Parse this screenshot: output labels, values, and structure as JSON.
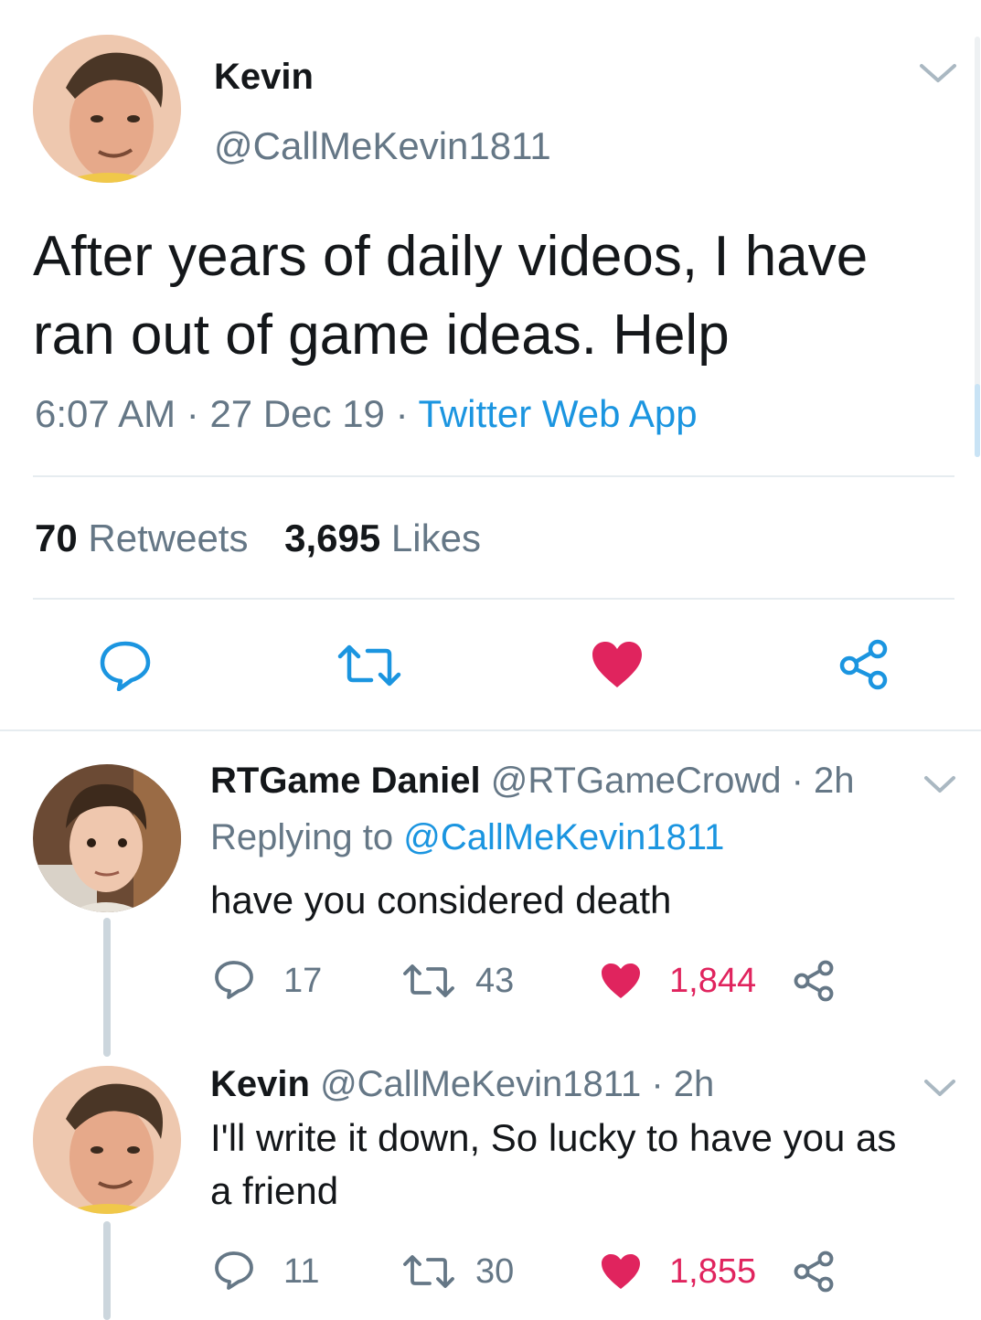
{
  "main_tweet": {
    "author_name": "Kevin",
    "author_handle": "@CallMeKevin1811",
    "text_line1": "After years of daily videos, I have",
    "text_line2": "ran out of game ideas. Help",
    "time": "6:07 AM",
    "sep1": "·",
    "date": "27 Dec 19",
    "sep2": "·",
    "source": "Twitter Web App",
    "retweets_count": "70",
    "retweets_label": "Retweets",
    "likes_count": "3,695",
    "likes_label": "Likes"
  },
  "replies": [
    {
      "author_name": "RTGame Daniel",
      "author_handle": "@RTGameCrowd",
      "time": "· 2h",
      "replying_prefix": "Replying to",
      "replying_handle": "@CallMeKevin1811",
      "text": "have you considered death",
      "reply_count": "17",
      "retweet_count": "43",
      "like_count": "1,844"
    },
    {
      "author_name": "Kevin",
      "author_handle": "@CallMeKevin1811",
      "time": "· 2h",
      "text_line1": "I'll write it down, So lucky to have you as",
      "text_line2": "a friend",
      "reply_count": "11",
      "retweet_count": "30",
      "like_count": "1,855"
    }
  ],
  "colors": {
    "like_active": "#e0245e",
    "link": "#1b95e0",
    "muted": "#657786",
    "icon": "#1b95e0"
  },
  "icons": [
    "chevron-down-icon",
    "reply-icon",
    "retweet-icon",
    "heart-icon",
    "share-icon"
  ]
}
